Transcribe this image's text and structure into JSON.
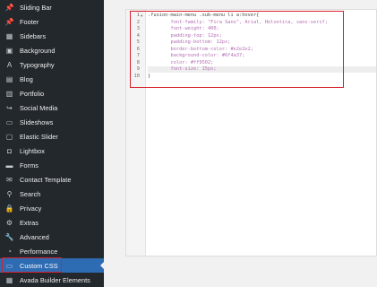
{
  "sidebar": {
    "items": [
      {
        "label": "Sliding Bar",
        "icon": "pin-icon",
        "glyph": "📌"
      },
      {
        "label": "Footer",
        "icon": "pin-icon",
        "glyph": "📌"
      },
      {
        "label": "Sidebars",
        "icon": "sidebar-layout-icon",
        "glyph": "▦"
      },
      {
        "label": "Background",
        "icon": "image-icon",
        "glyph": "▣"
      },
      {
        "label": "Typography",
        "icon": "typography-icon",
        "glyph": "A"
      },
      {
        "label": "Blog",
        "icon": "blog-icon",
        "glyph": "▤"
      },
      {
        "label": "Portfolio",
        "icon": "portfolio-icon",
        "glyph": "▥"
      },
      {
        "label": "Social Media",
        "icon": "share-icon",
        "glyph": "↪"
      },
      {
        "label": "Slideshows",
        "icon": "slideshow-icon",
        "glyph": "▭"
      },
      {
        "label": "Elastic Slider",
        "icon": "slider-icon",
        "glyph": "▢"
      },
      {
        "label": "Lightbox",
        "icon": "lightbox-icon",
        "glyph": "◘"
      },
      {
        "label": "Forms",
        "icon": "forms-icon",
        "glyph": "▬"
      },
      {
        "label": "Contact Template",
        "icon": "contact-icon",
        "glyph": "✉"
      },
      {
        "label": "Search",
        "icon": "search-icon",
        "glyph": "⚲"
      },
      {
        "label": "Privacy",
        "icon": "lock-icon",
        "glyph": "🔒"
      },
      {
        "label": "Extras",
        "icon": "gear-icon",
        "glyph": "⚙"
      },
      {
        "label": "Advanced",
        "icon": "wrench-icon",
        "glyph": "🔧"
      },
      {
        "label": "Performance",
        "icon": "speedometer-icon",
        "glyph": "◔"
      },
      {
        "label": "Custom CSS",
        "icon": "css-icon",
        "glyph": "▭"
      },
      {
        "label": "Avada Builder Elements",
        "icon": "builder-icon",
        "glyph": "▦"
      }
    ],
    "active_label": "Custom CSS"
  },
  "editor": {
    "line_numbers": [
      "1",
      "2",
      "3",
      "4",
      "5",
      "6",
      "7",
      "8",
      "9",
      "10"
    ],
    "lines": [
      ".fusion-main-menu .sub-menu li a:hover{",
      "        font-family: \"Fira Sans\", Arial, Helvetica, sans-serif;",
      "        font-weight: 400;",
      "        padding-top: 12px;",
      "        padding-bottom: 12px;",
      "        border-bottom-color: #e2e2e2;",
      "        background-color: #6f4a37;",
      "        color: #ff9502;",
      "        font-size: 15px;",
      "}"
    ],
    "fold_marker": "▾"
  },
  "colors": {
    "sidebar_bg": "#23282d",
    "active_bg": "#2d6bb3",
    "highlight_border": "#d6202d",
    "code_text": "#b36fb3"
  }
}
